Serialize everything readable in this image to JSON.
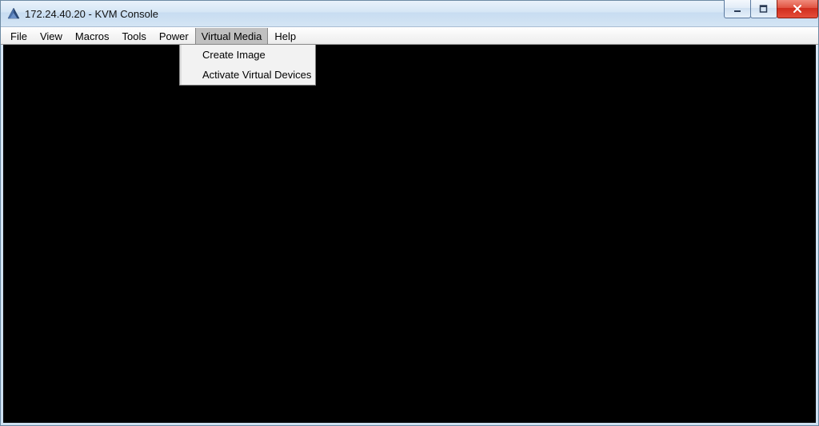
{
  "window": {
    "title": "172.24.40.20 - KVM Console"
  },
  "menubar": {
    "items": [
      {
        "label": "File",
        "active": false
      },
      {
        "label": "View",
        "active": false
      },
      {
        "label": "Macros",
        "active": false
      },
      {
        "label": "Tools",
        "active": false
      },
      {
        "label": "Power",
        "active": false
      },
      {
        "label": "Virtual Media",
        "active": true
      },
      {
        "label": "Help",
        "active": false
      }
    ]
  },
  "dropdown": {
    "items": [
      {
        "label": "Create Image"
      },
      {
        "label": "Activate Virtual Devices"
      }
    ]
  }
}
